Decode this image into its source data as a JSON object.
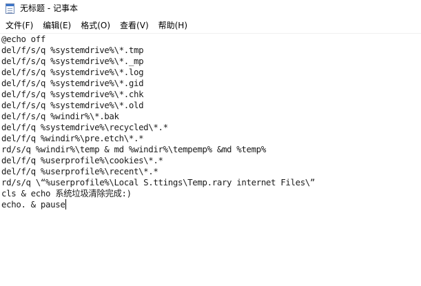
{
  "window": {
    "title": "无标题 - 记事本"
  },
  "menu": {
    "items": [
      {
        "label": "文件(F)",
        "name": "menu-file"
      },
      {
        "label": "编辑(E)",
        "name": "menu-edit"
      },
      {
        "label": "格式(O)",
        "name": "menu-format"
      },
      {
        "label": "查看(V)",
        "name": "menu-view"
      },
      {
        "label": "帮助(H)",
        "name": "menu-help"
      }
    ]
  },
  "editor": {
    "lines": [
      "@echo off",
      "del/f/s/q %systemdrive%\\*.tmp",
      "del/f/s/q %systemdrive%\\*._mp",
      "del/f/s/q %systemdrive%\\*.log",
      "del/f/s/q %systemdrive%\\*.gid",
      "del/f/s/q %systemdrive%\\*.chk",
      "del/f/s/q %systemdrive%\\*.old",
      "del/f/s/q %windir%\\*.bak",
      "del/f/q %systemdrive%\\recycled\\*.*",
      "del/f/q %windir%\\pre.etch\\*.*",
      "rd/s/q %windir%\\temp & md %windir%\\tempemp% &md %temp%",
      "del/f/q %userprofile%\\cookies\\*.*",
      "del/f/q %userprofile%\\recent\\*.*",
      "rd/s/q \\“%userprofile%\\Local S.ttings\\Temp.rary internet Files\\”",
      "cls & echo 系统垃圾清除完成:)",
      "echo. & pause"
    ]
  }
}
